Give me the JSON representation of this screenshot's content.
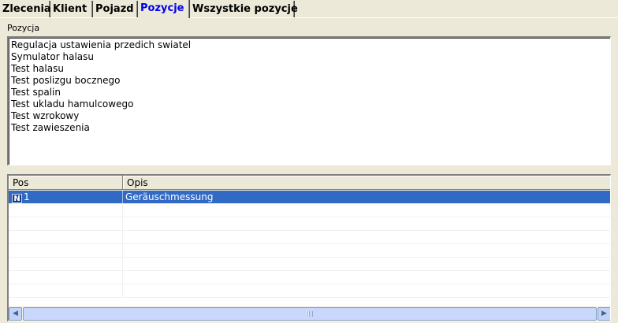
{
  "tabs": [
    {
      "label": "Zlecenia"
    },
    {
      "label": "Klient"
    },
    {
      "label": "Pojazd"
    },
    {
      "label": "Pozycje",
      "active": true
    },
    {
      "label": "Wszystkie pozycje"
    }
  ],
  "pozycja": {
    "label": "Pozycja",
    "items": [
      "Regulacja ustawienia przedich swiatel",
      "Symulator halasu",
      "Test halasu",
      "Test poslizgu bocznego",
      "Test spalin",
      "Test ukladu hamulcowego",
      "Test wzrokowy",
      "Test zawieszenia"
    ]
  },
  "grid": {
    "columns": [
      "Pos",
      "Opis"
    ],
    "rows": [
      {
        "indicator": "N",
        "pos": "1",
        "opis": "Geräuschmessung",
        "selected": true
      }
    ]
  },
  "colors": {
    "background": "#ece9d8",
    "active_tab_text": "#0000ee",
    "selection": "#316ac5"
  },
  "icons": {
    "row_indicator": "new-record-icon",
    "scroll_left": "arrow-left-icon",
    "scroll_right": "arrow-right-icon"
  }
}
